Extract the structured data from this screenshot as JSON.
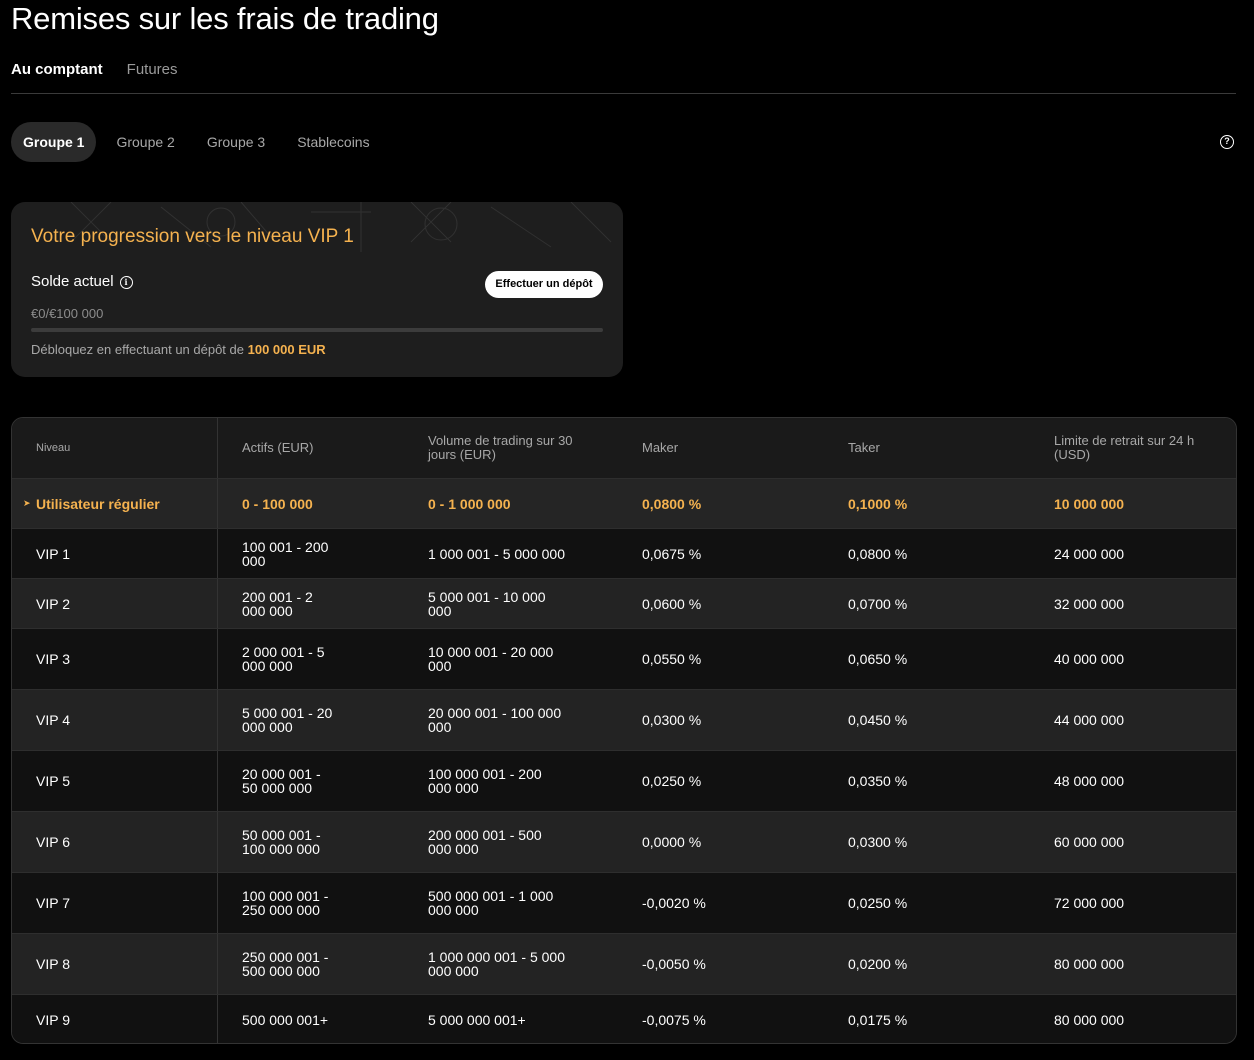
{
  "page_title": "Remises sur les frais de trading",
  "main_tabs": [
    {
      "label": "Au comptant",
      "active": true
    },
    {
      "label": "Futures",
      "active": false
    }
  ],
  "group_tabs": [
    {
      "label": "Groupe 1",
      "active": true
    },
    {
      "label": "Groupe 2",
      "active": false
    },
    {
      "label": "Groupe 3",
      "active": false
    },
    {
      "label": "Stablecoins",
      "active": false
    }
  ],
  "help_icon": "question-circle-icon",
  "progress_card": {
    "title": "Votre progression vers le niveau VIP 1",
    "balance_label": "Solde actuel",
    "info_icon": "info-circle-icon",
    "deposit_button": "Effectuer un dépôt",
    "balance_value": "€0/€100 000",
    "progress_fraction": 0,
    "unlock_text": "Débloquez en effectuant un dépôt de",
    "unlock_amount": "100 000 EUR",
    "accent_color": "#f5b24f"
  },
  "table": {
    "headers": [
      "Niveau",
      "Actifs (EUR)",
      "Volume de trading sur 30 jours (EUR)",
      "Maker",
      "Taker",
      "Limite de retrait sur 24 h (USD)"
    ],
    "current_marker": "➤",
    "rows": [
      {
        "level": "Utilisateur régulier",
        "assets": "0 - 100 000",
        "volume": "0 - 1 000 000",
        "maker": "0,0800 %",
        "taker": "0,1000 %",
        "limit": "10 000 000",
        "current": true
      },
      {
        "level": "VIP 1",
        "assets": "100 001 - 200 000",
        "volume": "1 000 001 - 5 000 000",
        "maker": "0,0675 %",
        "taker": "0,0800 %",
        "limit": "24 000 000"
      },
      {
        "level": "VIP 2",
        "assets": "200 001 - 2 000 000",
        "volume": "5 000 001 - 10 000 000",
        "maker": "0,0600 %",
        "taker": "0,0700 %",
        "limit": "32 000 000"
      },
      {
        "level": "VIP 3",
        "assets": "2 000 001 - 5 000 000",
        "volume": "10 000 001 - 20 000 000",
        "maker": "0,0550 %",
        "taker": "0,0650 %",
        "limit": "40 000 000"
      },
      {
        "level": "VIP 4",
        "assets": "5 000 001 - 20 000 000",
        "volume": "20 000 001 - 100 000 000",
        "maker": "0,0300 %",
        "taker": "0,0450 %",
        "limit": "44 000 000"
      },
      {
        "level": "VIP 5",
        "assets": "20 000 001 - 50 000 000",
        "volume": "100 000 001 - 200 000 000",
        "maker": "0,0250 %",
        "taker": "0,0350 %",
        "limit": "48 000 000"
      },
      {
        "level": "VIP 6",
        "assets": "50 000 001 - 100 000 000",
        "volume": "200 000 001 - 500 000 000",
        "maker": "0,0000 %",
        "taker": "0,0300 %",
        "limit": "60 000 000"
      },
      {
        "level": "VIP 7",
        "assets": "100 000 001 - 250 000 000",
        "volume": "500 000 001 - 1 000 000 000",
        "maker": "-0,0020 %",
        "taker": "0,0250 %",
        "limit": "72 000 000"
      },
      {
        "level": "VIP 8",
        "assets": "250 000 001 - 500 000 000",
        "volume": "1 000 000 001 - 5 000 000 000",
        "maker": "-0,0050 %",
        "taker": "0,0200 %",
        "limit": "80 000 000"
      },
      {
        "level": "VIP 9",
        "assets": "500 000 001+",
        "volume": "5 000 000 001+",
        "maker": "-0,0075 %",
        "taker": "0,0175 %",
        "limit": "80 000 000"
      }
    ]
  }
}
